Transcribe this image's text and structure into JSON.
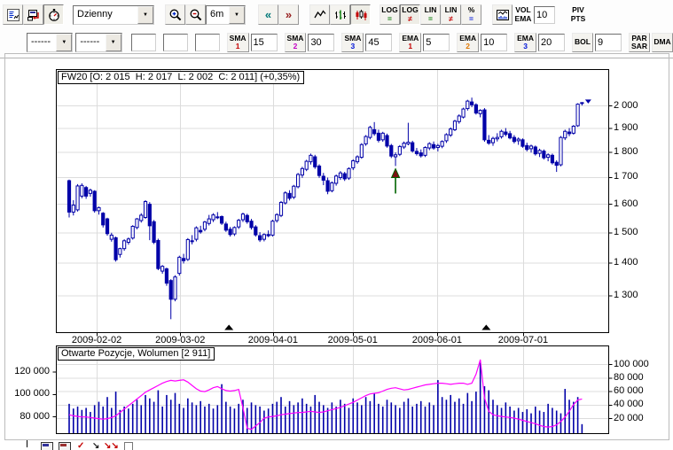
{
  "colors": {
    "candle": "#0000a8",
    "volume_bar": "#0000a8",
    "open_interest_line": "#ff00ff",
    "grid": "#dcdcdc",
    "frame": "#000000",
    "signal_arrow_green": "#006400",
    "signal_arrow_fill": "#7a1010",
    "nav_back": "#007878",
    "nav_fwd": "#982222"
  },
  "icons": {
    "dropdown_arrow": "▼"
  },
  "toolbar_top": {
    "period_value": "Dzienny",
    "range_value": "6m",
    "nav_back_label": "«",
    "nav_fwd_label": "»",
    "scale_buttons": [
      {
        "label": "LOG",
        "glyph": "="
      },
      {
        "label": "LOG",
        "glyph": "≠"
      },
      {
        "label": "LIN",
        "glyph": "="
      },
      {
        "label": "LIN",
        "glyph": "≠"
      },
      {
        "label": "%",
        "glyph": "="
      }
    ],
    "vol_ema": {
      "line1": "VOL",
      "line2": "EMA",
      "value": "10"
    },
    "piv": {
      "line1": "PIV",
      "line2": "PTS"
    }
  },
  "toolbar_indicators": {
    "dropdown1_value": "------",
    "dropdown2_value": "------",
    "groups": [
      {
        "label": "SMA",
        "index": "1",
        "value": "15"
      },
      {
        "label": "SMA",
        "index": "2",
        "value": "30"
      },
      {
        "label": "SMA",
        "index": "3",
        "value": "45"
      },
      {
        "label": "EMA",
        "index": "1",
        "value": "5"
      },
      {
        "label": "EMA",
        "index": "2",
        "value": "10"
      },
      {
        "label": "EMA",
        "index": "3",
        "value": "20"
      },
      {
        "label": "BOL",
        "index": "",
        "value": "9"
      }
    ],
    "parsar": {
      "line1": "PAR",
      "line2": "SAR"
    },
    "dma_label": "DMA"
  },
  "chart_data": [
    {
      "type": "candlestick",
      "title": "FW20 [O: 2 015  H: 2 017  L: 2 002  C: 2 011] (+0,35%)",
      "symbol": "FW20",
      "ohlc_display": {
        "open": "2 015",
        "high": "2 017",
        "low": "2 002",
        "close": "2 011",
        "change_pct": "+0,35%"
      },
      "y_scale": "log",
      "ylim": [
        1196,
        2172
      ],
      "y_ticks": [
        {
          "value": 2000,
          "label": "2 000"
        },
        {
          "value": 1900,
          "label": "1 900"
        },
        {
          "value": 1800,
          "label": "1 800"
        },
        {
          "value": 1700,
          "label": "1 700"
        },
        {
          "value": 1600,
          "label": "1 600"
        },
        {
          "value": 1500,
          "label": "1 500"
        },
        {
          "value": 1400,
          "label": "1 400"
        },
        {
          "value": 1300,
          "label": "1 300"
        }
      ],
      "x_ticks": [
        {
          "label": "2009-02-02",
          "index": 6.5
        },
        {
          "label": "2009-03-02",
          "index": 26.2
        },
        {
          "label": "2009-04-01",
          "index": 48.1
        },
        {
          "label": "2009-05-01",
          "index": 66.9
        },
        {
          "label": "2009-06-01",
          "index": 86.8
        },
        {
          "label": "2009-07-01",
          "index": 107.1
        }
      ],
      "candles_ohlc": [
        [
          1688,
          1692,
          1553,
          1572
        ],
        [
          1572,
          1615,
          1560,
          1597
        ],
        [
          1580,
          1675,
          1574,
          1668
        ],
        [
          1630,
          1678,
          1622,
          1670
        ],
        [
          1662,
          1668,
          1620,
          1630
        ],
        [
          1640,
          1658,
          1628,
          1652
        ],
        [
          1648,
          1652,
          1570,
          1577
        ],
        [
          1577,
          1592,
          1563,
          1588
        ],
        [
          1568,
          1572,
          1518,
          1527
        ],
        [
          1548,
          1552,
          1490,
          1497
        ],
        [
          1478,
          1500,
          1470,
          1492
        ],
        [
          1483,
          1487,
          1405,
          1411
        ],
        [
          1428,
          1450,
          1418,
          1447
        ],
        [
          1447,
          1478,
          1440,
          1473
        ],
        [
          1468,
          1484,
          1460,
          1479
        ],
        [
          1482,
          1526,
          1477,
          1522
        ],
        [
          1518,
          1551,
          1512,
          1548
        ],
        [
          1542,
          1568,
          1535,
          1561
        ],
        [
          1553,
          1615,
          1548,
          1610
        ],
        [
          1600,
          1608,
          1475,
          1524
        ],
        [
          1538,
          1544,
          1462,
          1468
        ],
        [
          1474,
          1480,
          1378,
          1383
        ],
        [
          1375,
          1394,
          1367,
          1390
        ],
        [
          1382,
          1386,
          1330,
          1338
        ],
        [
          1346,
          1350,
          1233,
          1290
        ],
        [
          1290,
          1362,
          1284,
          1357
        ],
        [
          1368,
          1424,
          1361,
          1419
        ],
        [
          1415,
          1430,
          1399,
          1408
        ],
        [
          1412,
          1482,
          1407,
          1477
        ],
        [
          1470,
          1492,
          1461,
          1473
        ],
        [
          1478,
          1522,
          1471,
          1517
        ],
        [
          1508,
          1524,
          1497,
          1503
        ],
        [
          1512,
          1541,
          1505,
          1537
        ],
        [
          1532,
          1562,
          1525,
          1548
        ],
        [
          1545,
          1568,
          1537,
          1562
        ],
        [
          1555,
          1572,
          1547,
          1552
        ],
        [
          1556,
          1560,
          1527,
          1533
        ],
        [
          1530,
          1538,
          1503,
          1509
        ],
        [
          1512,
          1520,
          1487,
          1494
        ],
        [
          1496,
          1522,
          1489,
          1518
        ],
        [
          1520,
          1548,
          1513,
          1543
        ],
        [
          1545,
          1570,
          1537,
          1565
        ],
        [
          1560,
          1566,
          1531,
          1538
        ],
        [
          1540,
          1548,
          1511,
          1518
        ],
        [
          1520,
          1526,
          1487,
          1493
        ],
        [
          1490,
          1502,
          1469,
          1476
        ],
        [
          1478,
          1498,
          1471,
          1494
        ],
        [
          1494,
          1508,
          1485,
          1490
        ],
        [
          1492,
          1545,
          1487,
          1540
        ],
        [
          1542,
          1568,
          1535,
          1563
        ],
        [
          1560,
          1612,
          1554,
          1607
        ],
        [
          1605,
          1648,
          1599,
          1642
        ],
        [
          1640,
          1652,
          1614,
          1622
        ],
        [
          1626,
          1672,
          1619,
          1667
        ],
        [
          1665,
          1718,
          1659,
          1712
        ],
        [
          1710,
          1742,
          1699,
          1735
        ],
        [
          1732,
          1770,
          1725,
          1764
        ],
        [
          1762,
          1795,
          1751,
          1788
        ],
        [
          1782,
          1790,
          1734,
          1742
        ],
        [
          1745,
          1752,
          1699,
          1708
        ],
        [
          1705,
          1718,
          1671,
          1690
        ],
        [
          1688,
          1700,
          1637,
          1648
        ],
        [
          1650,
          1685,
          1644,
          1680
        ],
        [
          1678,
          1712,
          1669,
          1706
        ],
        [
          1700,
          1725,
          1691,
          1718
        ],
        [
          1715,
          1722,
          1687,
          1695
        ],
        [
          1698,
          1740,
          1691,
          1735
        ],
        [
          1738,
          1772,
          1729,
          1766
        ],
        [
          1762,
          1788,
          1754,
          1782
        ],
        [
          1780,
          1838,
          1774,
          1832
        ],
        [
          1835,
          1872,
          1827,
          1866
        ],
        [
          1862,
          1912,
          1854,
          1905
        ],
        [
          1895,
          1928,
          1869,
          1878
        ],
        [
          1880,
          1895,
          1841,
          1850
        ],
        [
          1852,
          1886,
          1844,
          1880
        ],
        [
          1870,
          1878,
          1819,
          1826
        ],
        [
          1828,
          1835,
          1777,
          1785
        ],
        [
          1782,
          1800,
          1745,
          1790
        ],
        [
          1792,
          1830,
          1785,
          1824
        ],
        [
          1822,
          1845,
          1814,
          1838
        ],
        [
          1835,
          1925,
          1829,
          1842
        ],
        [
          1840,
          1848,
          1799,
          1806
        ],
        [
          1804,
          1818,
          1787,
          1795
        ],
        [
          1798,
          1812,
          1779,
          1786
        ],
        [
          1788,
          1825,
          1781,
          1820
        ],
        [
          1818,
          1842,
          1809,
          1836
        ],
        [
          1832,
          1845,
          1811,
          1818
        ],
        [
          1820,
          1835,
          1804,
          1828
        ],
        [
          1825,
          1850,
          1817,
          1845
        ],
        [
          1848,
          1880,
          1839,
          1874
        ],
        [
          1872,
          1905,
          1864,
          1898
        ],
        [
          1895,
          1938,
          1889,
          1932
        ],
        [
          1930,
          1962,
          1921,
          1955
        ],
        [
          1950,
          1992,
          1944,
          1986
        ],
        [
          1988,
          2028,
          1979,
          2022
        ],
        [
          2018,
          2038,
          1994,
          2005
        ],
        [
          2005,
          2012,
          1961,
          1968
        ],
        [
          1965,
          1985,
          1949,
          1980
        ],
        [
          1982,
          1990,
          1844,
          1852
        ],
        [
          1850,
          1872,
          1831,
          1838
        ],
        [
          1840,
          1865,
          1827,
          1858
        ],
        [
          1856,
          1880,
          1845,
          1862
        ],
        [
          1865,
          1895,
          1857,
          1888
        ],
        [
          1885,
          1902,
          1867,
          1875
        ],
        [
          1878,
          1890,
          1854,
          1860
        ],
        [
          1862,
          1872,
          1837,
          1845
        ],
        [
          1848,
          1862,
          1831,
          1855
        ],
        [
          1852,
          1858,
          1819,
          1825
        ],
        [
          1828,
          1840,
          1804,
          1812
        ],
        [
          1815,
          1832,
          1799,
          1826
        ],
        [
          1822,
          1828,
          1787,
          1794
        ],
        [
          1796,
          1815,
          1781,
          1808
        ],
        [
          1805,
          1812,
          1771,
          1778
        ],
        [
          1780,
          1796,
          1764,
          1790
        ],
        [
          1788,
          1795,
          1751,
          1758
        ],
        [
          1760,
          1768,
          1722,
          1748
        ],
        [
          1750,
          1868,
          1744,
          1862
        ],
        [
          1860,
          1895,
          1851,
          1888
        ],
        [
          1885,
          1902,
          1867,
          1878
        ],
        [
          1880,
          1915,
          1874,
          1910
        ],
        [
          1912,
          2012,
          1907,
          2008
        ],
        [
          2015,
          2017,
          2002,
          2011
        ]
      ],
      "expiry_markers": [
        37.7,
        98.4
      ],
      "buy_arrow_index": 77,
      "last_close": 2011
    },
    {
      "type": "bar+line",
      "title": "Otwarte Pozycje, Wolumen [2 911]",
      "left_ticks": [
        {
          "value": 120000,
          "label": "120 000"
        },
        {
          "value": 100000,
          "label": "100 000"
        },
        {
          "value": 80000,
          "label": "80 000"
        }
      ],
      "right_ticks": [
        {
          "value": 100000,
          "label": "100 000"
        },
        {
          "value": 80000,
          "label": "80 000"
        },
        {
          "value": 60000,
          "label": "60 000"
        },
        {
          "value": 40000,
          "label": "40 000"
        },
        {
          "value": 20000,
          "label": "20 000"
        }
      ],
      "volume_bars": [
        42000,
        35000,
        38000,
        33000,
        36000,
        30000,
        40000,
        45000,
        38000,
        52000,
        36000,
        60000,
        33000,
        38000,
        35000,
        42000,
        48000,
        40000,
        55000,
        50000,
        45000,
        62000,
        38000,
        55000,
        48000,
        58000,
        42000,
        36000,
        50000,
        44000,
        40000,
        46000,
        38000,
        42000,
        35000,
        40000,
        71000,
        45000,
        38000,
        35000,
        42000,
        48000,
        36000,
        44000,
        40000,
        38000,
        32000,
        35000,
        42000,
        45000,
        52000,
        38000,
        46000,
        40000,
        44000,
        50000,
        42000,
        38000,
        55000,
        45000,
        40000,
        36000,
        44000,
        38000,
        48000,
        42000,
        36000,
        50000,
        44000,
        40000,
        52000,
        46000,
        58000,
        42000,
        38000,
        48000,
        44000,
        40000,
        36000,
        45000,
        50000,
        38000,
        42000,
        46000,
        38000,
        44000,
        40000,
        77000,
        52000,
        48000,
        55000,
        45000,
        50000,
        42000,
        58000,
        46000,
        60000,
        105000,
        68000,
        62000,
        48000,
        40000,
        36000,
        44000,
        38000,
        32000,
        36000,
        30000,
        34000,
        28000,
        38000,
        32000,
        30000,
        42000,
        36000,
        32000,
        28000,
        64000,
        48000,
        45000,
        52000,
        12000
      ],
      "open_interest_line": [
        82000,
        81000,
        80500,
        80000,
        80000,
        79500,
        79000,
        78500,
        78000,
        78500,
        79500,
        81000,
        84000,
        87000,
        90000,
        93000,
        96000,
        99000,
        102000,
        104000,
        106000,
        108000,
        110000,
        111500,
        112500,
        112000,
        112500,
        113000,
        111000,
        108000,
        105000,
        103000,
        102500,
        104000,
        106000,
        107000,
        105000,
        103500,
        103000,
        103500,
        104500,
        88000,
        70000,
        69000,
        72000,
        75000,
        79000,
        80000,
        80500,
        81000,
        82000,
        82500,
        83000,
        83500,
        84000,
        84000,
        84500,
        85000,
        84500,
        84000,
        84500,
        85500,
        86500,
        87500,
        88500,
        90000,
        91500,
        93000,
        95000,
        97000,
        99000,
        100500,
        101000,
        101500,
        103000,
        104500,
        105500,
        106000,
        105000,
        104000,
        104500,
        105500,
        106500,
        107500,
        108500,
        109000,
        109500,
        110000,
        110000,
        109500,
        109000,
        109500,
        110000,
        110000,
        109000,
        110000,
        118000,
        131000,
        97000,
        85000,
        82000,
        81000,
        80500,
        80000,
        79500,
        79000,
        78000,
        77000,
        76000,
        75000,
        74000,
        72500,
        71500,
        71000,
        71500,
        73000,
        76000,
        80000,
        85000,
        91000,
        95000,
        96000
      ]
    }
  ]
}
